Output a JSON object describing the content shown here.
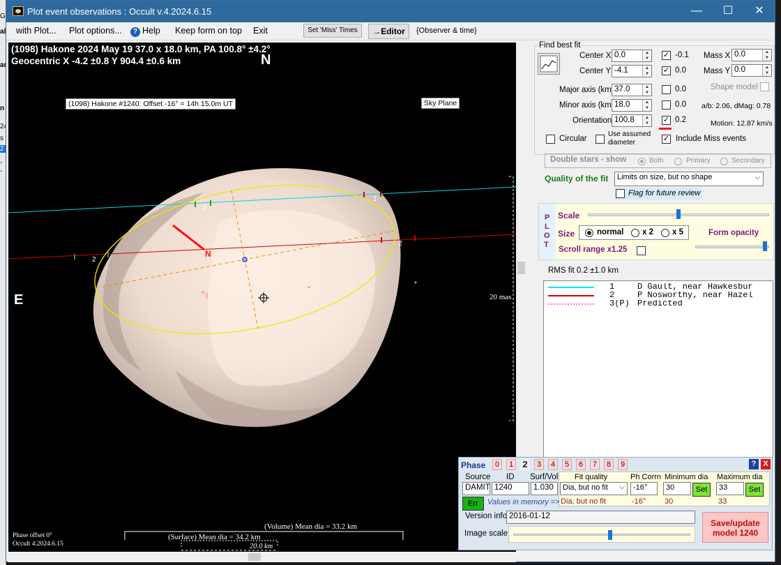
{
  "window": {
    "title": "Plot event observations : Occult v.4.2024.6.15",
    "controls": [
      "—",
      "☐",
      "✕"
    ]
  },
  "background_strip": [
    "G",
    "al",
    "ar",
    "n",
    "24",
    "s",
    "2",
    "-",
    "-"
  ],
  "menu": {
    "with_plot": "with Plot...",
    "plot_options": "Plot options...",
    "help": "Help",
    "keep_on_top": "Keep form on top",
    "exit": "Exit",
    "set_miss_times": "Set 'Miss' Times",
    "editor": "→Editor",
    "observer_time": "{Observer & time}"
  },
  "plot": {
    "header_line1": "(1098) Hakone  2024 May 19  37.0 x 18.0 km, PA 100.8° ±4.2°",
    "header_line2": "Geocentric  X  -4.2 ±0.8  Y 904.4 ±0.6 km",
    "north": "N",
    "east": "E",
    "offset_label": "(1098) Hakone #1240: Offset -16° = 14h 15.0m UT",
    "sky_plane": "Sky Plane",
    "scale_mas": "20 mas",
    "chord_labels": [
      "1",
      "1",
      "2",
      "2",
      "3"
    ],
    "north_marker": "N",
    "phase_offset": "Phase offset 0°",
    "version": "Occult 4.2024.6.15",
    "volume_dia": "(Volume) Mean dia = 33.2 km",
    "surface_dia": "(Surface) Mean dia = 34.2 km",
    "km_scale": "20.0 km"
  },
  "fit": {
    "group_title": "Find best fit",
    "center_x_label": "Center X",
    "center_x": "0.0",
    "center_y_label": "Center Y",
    "center_y": "-4.1",
    "major_label": "Major axis (km)",
    "major": "37.0",
    "minor_label": "Minor axis (km)",
    "minor": "18.0",
    "orientation_label": "Orientation",
    "orientation": "100.8",
    "check_values": [
      "-0.1",
      "0.0",
      "0.0",
      "0.0",
      "0.2"
    ],
    "mass_x_label": "Mass X",
    "mass_x": "0.0",
    "mass_y_label": "Mass Y",
    "mass_y": "0.0",
    "shape_model": "Shape model",
    "ab_dmag": "a/b: 2.06, dMag: 0.78",
    "motion": "Motion: 12.87 km/s",
    "circular": "Circular",
    "use_assumed_1": "Use assumed",
    "use_assumed_2": "diameter",
    "include_miss": "Include Miss events",
    "double_stars": "Double stars - show",
    "both": "Both",
    "primary": "Primary",
    "secondary": "Secondary",
    "quality_label": "Quality of the fit",
    "quality_value": "Limits on size, but no shape",
    "flag_review": "Flag for future review"
  },
  "plot_controls": {
    "plot_letters": [
      "P",
      "L",
      "O",
      "T"
    ],
    "scale": "Scale",
    "size": "Size",
    "size_options": [
      "normal",
      "x 2",
      "x 5"
    ],
    "form_opacity": "Form opacity",
    "scroll_range": "Scroll range x1.25",
    "scale_slider_level": 0.5,
    "opacity_slider_level": 0.97
  },
  "rms": "RMS fit 0.2 ±1.0 km",
  "legend": [
    {
      "num": "1",
      "text": "D Gault, near Hawkesbur",
      "color": "#00e5ff",
      "style": "solid"
    },
    {
      "num": "2",
      "text": "P Nosworthy, near Hazel",
      "color": "#e00000",
      "style": "solid"
    },
    {
      "num": "3(P)",
      "text": "Predicted",
      "color": "#ff7aa0",
      "style": "dotted"
    }
  ],
  "phase_panel": {
    "phase_label": "Phase",
    "phases": [
      "0",
      "1",
      "2",
      "3",
      "4",
      "5",
      "6",
      "7",
      "8",
      "9"
    ],
    "selected_phase": "2",
    "source_label": "Source",
    "source": "DAMIT",
    "id_label": "ID",
    "id": "1240",
    "surfvol_label": "Surf/Vol",
    "surfvol": "1.030",
    "fit_quality_label": "Fit quality",
    "fit_quality": "Dia, but no fit",
    "phcorrn_label": "Ph Corrn",
    "phcorrn": "-16°",
    "min_dia_label": "Minimum dia",
    "min_dia": "30",
    "max_dia_label": "Maximum dia",
    "max_dia": "33",
    "set": "Set",
    "err": "Err",
    "values_in_memory": "Values in memory =>",
    "mem_fit": "Dia, but no fit",
    "mem_phcorrn": "-16°",
    "mem_min": "30",
    "mem_max": "33",
    "version_info_label": "Version info",
    "version_info": "2016-01-12",
    "image_scale_label": "Image scale",
    "image_scale_level": 0.55,
    "save_update": "Save/update",
    "save_model": "model 1240",
    "help": "?",
    "close": "X"
  }
}
